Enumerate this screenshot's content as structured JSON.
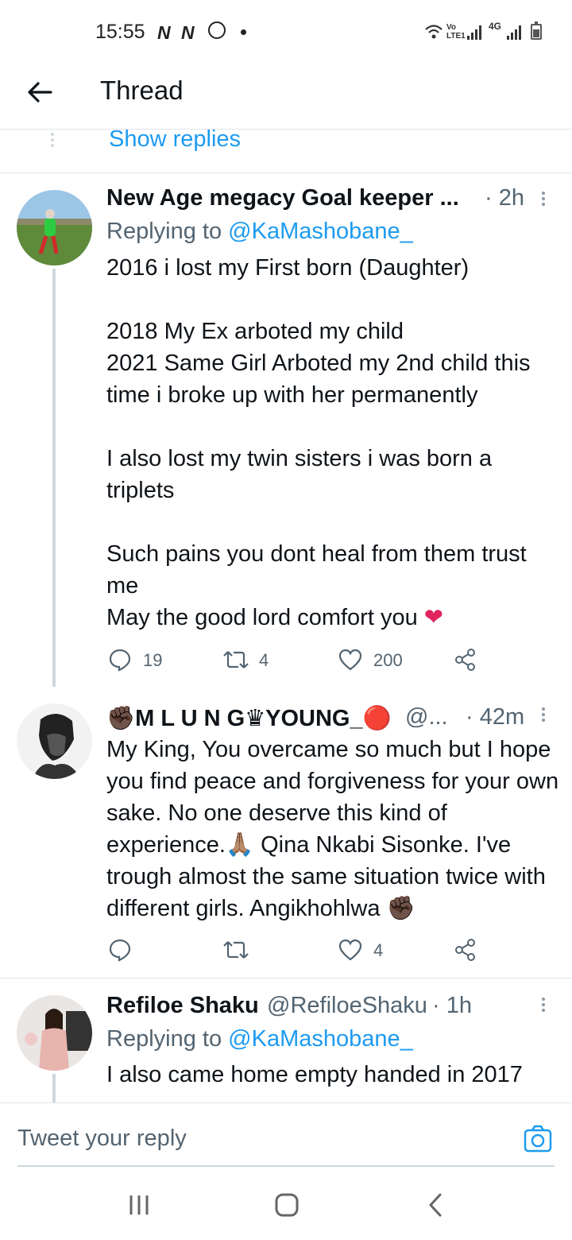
{
  "status_bar": {
    "time": "15:55",
    "notif_icons": [
      "N",
      "N"
    ],
    "volte_label": "Vo\nLTE1",
    "network_label": "4G"
  },
  "header": {
    "back_icon": "arrow-left-icon",
    "title": "Thread"
  },
  "show_replies": "Show replies",
  "tweets": [
    {
      "name": "New Age megacy Goal keeper ...",
      "time": "· 2h",
      "replying_prefix": "Replying to ",
      "replying_handle": "@KaMashobane_",
      "text": "2016 i lost my First born (Daughter)\n\n2018 My Ex arboted my child\n2021 Same Girl Arboted my 2nd child this time i broke up with her permanently\n\nI also lost my twin sisters i was born a triplets\n\nSuch pains you dont heal from them trust me\nMay the good lord comfort you",
      "emoji_end": "❤",
      "replies": "19",
      "retweets": "4",
      "likes": "200"
    },
    {
      "name_parts": [
        "✊🏿",
        "M L U N G",
        "♛",
        "YOUNG_",
        "🔴"
      ],
      "handle": "@...",
      "time": "· 42m",
      "text": "My King, You overcame so much but I hope you find peace and forgiveness for your own sake. No one deserve this kind of experience.🙏🏽 Qina Nkabi Sisonke. I've trough almost the same situation twice with different girls. Angikhohlwa ✊🏿",
      "replies": "",
      "retweets": "",
      "likes": "4"
    },
    {
      "name": "Refiloe Shaku",
      "handle": "@RefiloeShaku",
      "time": "· 1h",
      "replying_prefix": "Replying to ",
      "replying_handle": "@KaMashobane_",
      "text": "I also came home empty handed in 2017"
    }
  ],
  "reply_box": {
    "placeholder": "Tweet your reply",
    "camera_icon": "camera-icon"
  },
  "nav": {
    "recent": "recent-apps-icon",
    "home": "home-icon",
    "back": "back-icon"
  },
  "colors": {
    "accent": "#1d9bf0",
    "text": "#0f1419",
    "muted": "#536471",
    "like_heart": "#e0245e"
  }
}
